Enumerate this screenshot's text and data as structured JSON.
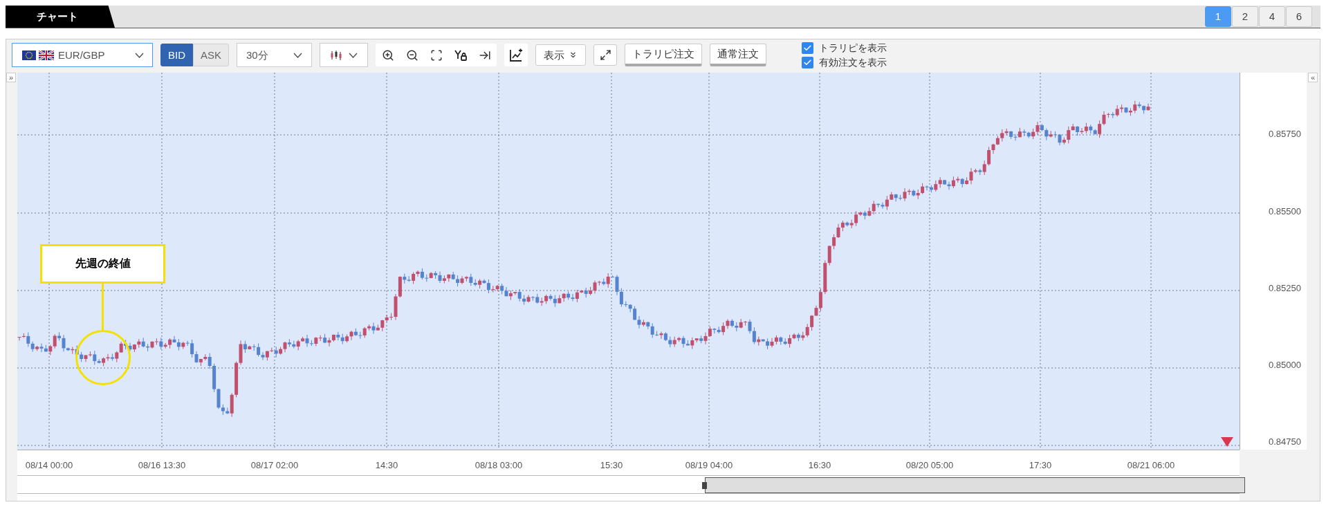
{
  "panel_tab": {
    "title": "チャート"
  },
  "layout_buttons": [
    {
      "label": "1",
      "selected": true
    },
    {
      "label": "2",
      "selected": false
    },
    {
      "label": "4",
      "selected": false
    },
    {
      "label": "6",
      "selected": false
    }
  ],
  "toolbar": {
    "pair": "EUR/GBP",
    "price_side": [
      {
        "label": "BID",
        "selected": true
      },
      {
        "label": "ASK",
        "selected": false
      }
    ],
    "timeframe": "30分",
    "display_menu": "表示",
    "order_buttons": [
      "トラリピ注文",
      "通常注文"
    ],
    "checkboxes": [
      {
        "label": "トラリピを表示",
        "checked": true
      },
      {
        "label": "有効注文を表示",
        "checked": true
      }
    ]
  },
  "chart": {
    "left_toggle": "»",
    "right_toggle": "«",
    "y_labels": [
      "0.85750",
      "0.85500",
      "0.85250",
      "0.85000",
      "0.84750"
    ],
    "x_labels": [
      "08/14 00:00",
      "08/16 13:30",
      "08/17 02:00",
      "14:30",
      "08/18 03:00",
      "15:30",
      "08/19 04:00",
      "16:30",
      "08/20 05:00",
      "17:30",
      "08/21 06:00"
    ],
    "annotation": "先週の終値"
  }
}
